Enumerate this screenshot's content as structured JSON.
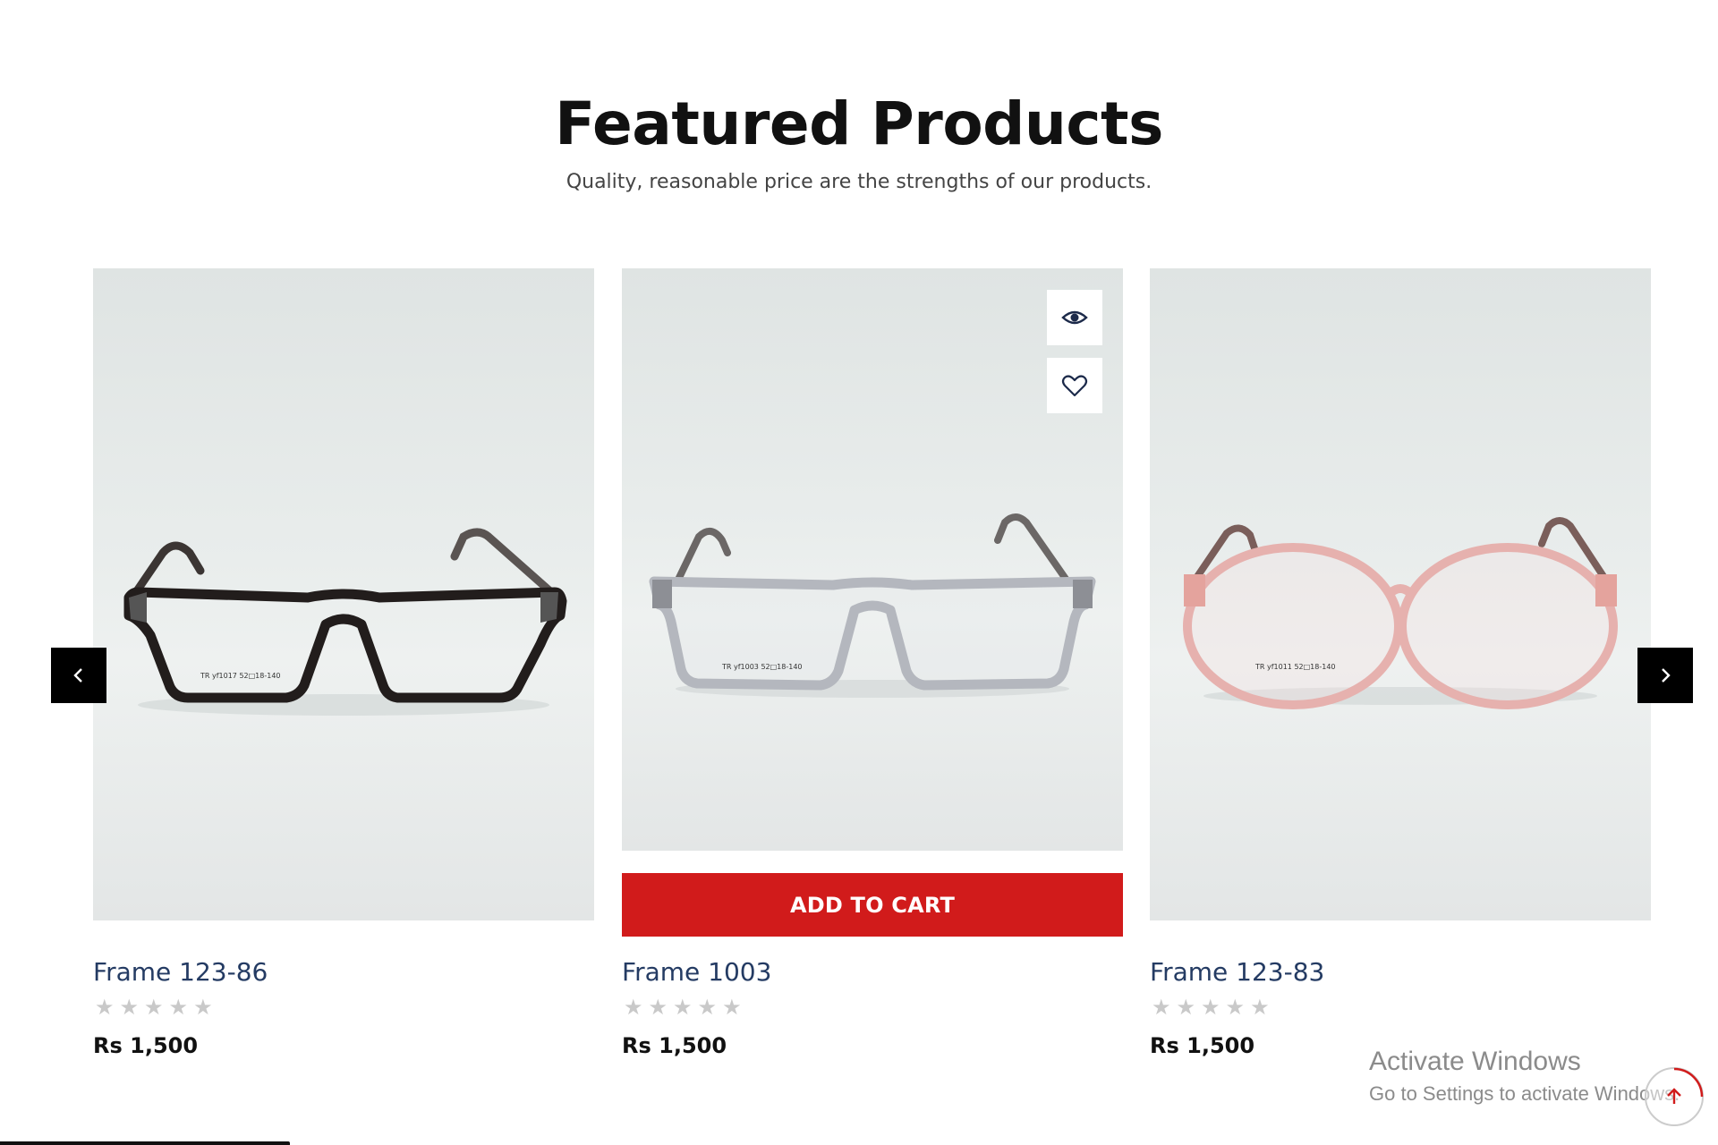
{
  "section": {
    "title": "Featured Products",
    "subtitle": "Quality, reasonable price are the strengths of our products."
  },
  "products": [
    {
      "name": "Frame 123-86",
      "price": "Rs 1,500",
      "rating": 0,
      "frame_color": "#2b2523",
      "lens_label": "TR yf1017  52□18-140"
    },
    {
      "name": "Frame 1003",
      "price": "Rs 1,500",
      "rating": 0,
      "frame_color": "#b9bcc4",
      "lens_label": "TR yf1003  52□18-140",
      "add_to_cart_label": "ADD TO CART"
    },
    {
      "name": "Frame 123-83",
      "price": "Rs 1,500",
      "rating": 0,
      "frame_color": "#e7b6b3",
      "lens_label": "TR yf1011  52□18-140"
    }
  ],
  "card_actions": {
    "quick_view_icon": "eye-icon",
    "wishlist_icon": "heart-icon"
  },
  "carousel": {
    "prev_icon": "chevron-left-icon",
    "next_icon": "chevron-right-icon"
  },
  "os_overlay": {
    "title": "Activate Windows",
    "subtitle": "Go to Settings to activate Windows."
  },
  "scroll_top_icon": "arrow-up-icon",
  "colors": {
    "accent": "#d11b1b",
    "product_title": "#243b63",
    "star_empty": "#c9c9c9"
  }
}
